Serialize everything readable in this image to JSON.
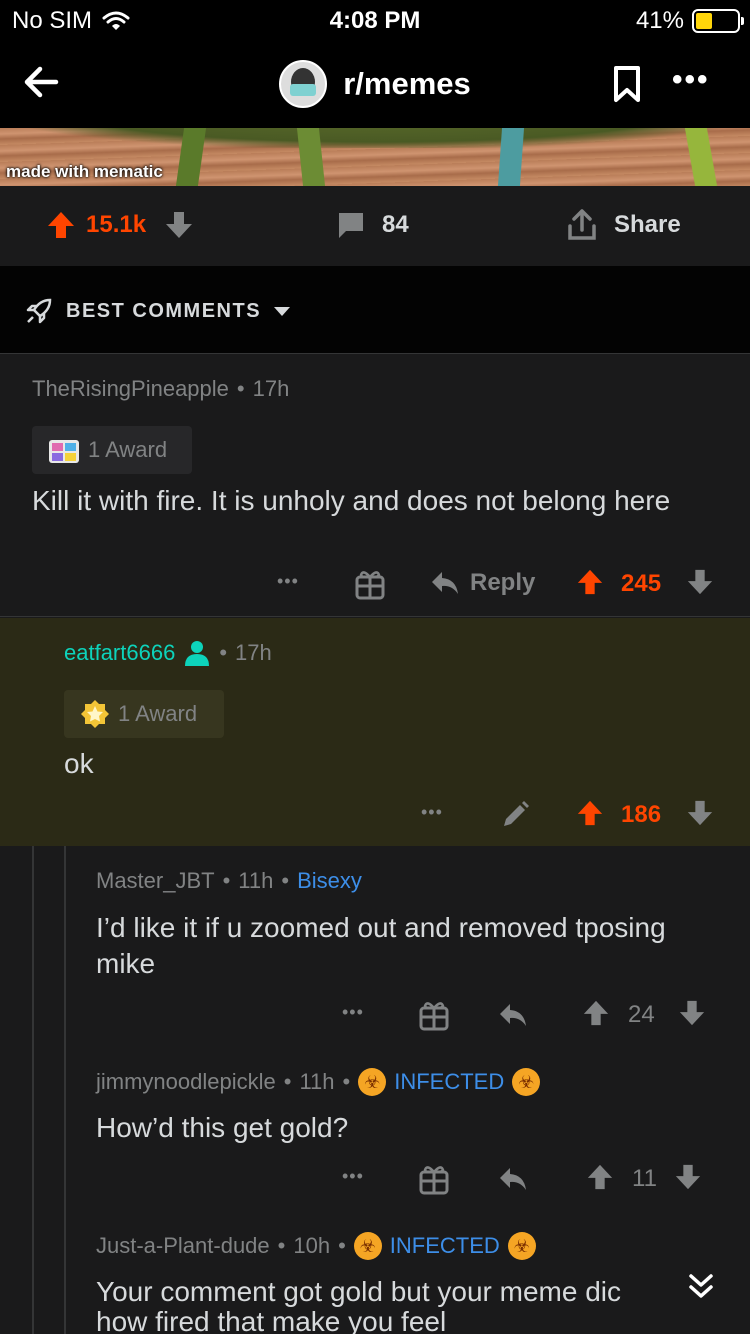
{
  "status_bar": {
    "carrier": "No SIM",
    "time": "4:08 PM",
    "battery_percent": "41%",
    "battery_level": 0.41
  },
  "nav": {
    "subreddit": "r/memes",
    "more_label": "•••"
  },
  "post": {
    "image_caption": "made with mematic",
    "score": "15.1k",
    "comment_count": "84",
    "share_label": "Share"
  },
  "sort": {
    "label": "BEST COMMENTS"
  },
  "comments": [
    {
      "author": "TheRisingPineapple",
      "age": "17h",
      "award": "1 Award",
      "body": "Kill it with fire. It is unholy and does not belong here",
      "reply_label": "Reply",
      "score": "245",
      "more_label": "•••"
    },
    {
      "author": "eatfart6666",
      "age": "17h",
      "award": "1 Award",
      "body": "ok",
      "score": "186",
      "more_label": "•••"
    },
    {
      "author": "Master_JBT",
      "age": "11h",
      "flair": "Bisexy",
      "body": "I’d like it if u zoomed out and removed tposing mike",
      "score": "24",
      "more_label": "•••"
    },
    {
      "author": "jimmynoodlepickle",
      "age": "11h",
      "flair": "INFECTED",
      "body": "How’d this get gold?",
      "score": "11",
      "more_label": "•••"
    },
    {
      "author": "Just-a-Plant-dude",
      "age": "10h",
      "flair": "INFECTED",
      "body_line1": "Your comment got gold but your meme dic",
      "body_line2": "how fired that make you feel"
    }
  ],
  "colors": {
    "upvote": "#ff4500",
    "op_green": "#0dd3bb",
    "flair_blue": "#3d8ee8",
    "highlight_bg": "#2b2a16"
  }
}
